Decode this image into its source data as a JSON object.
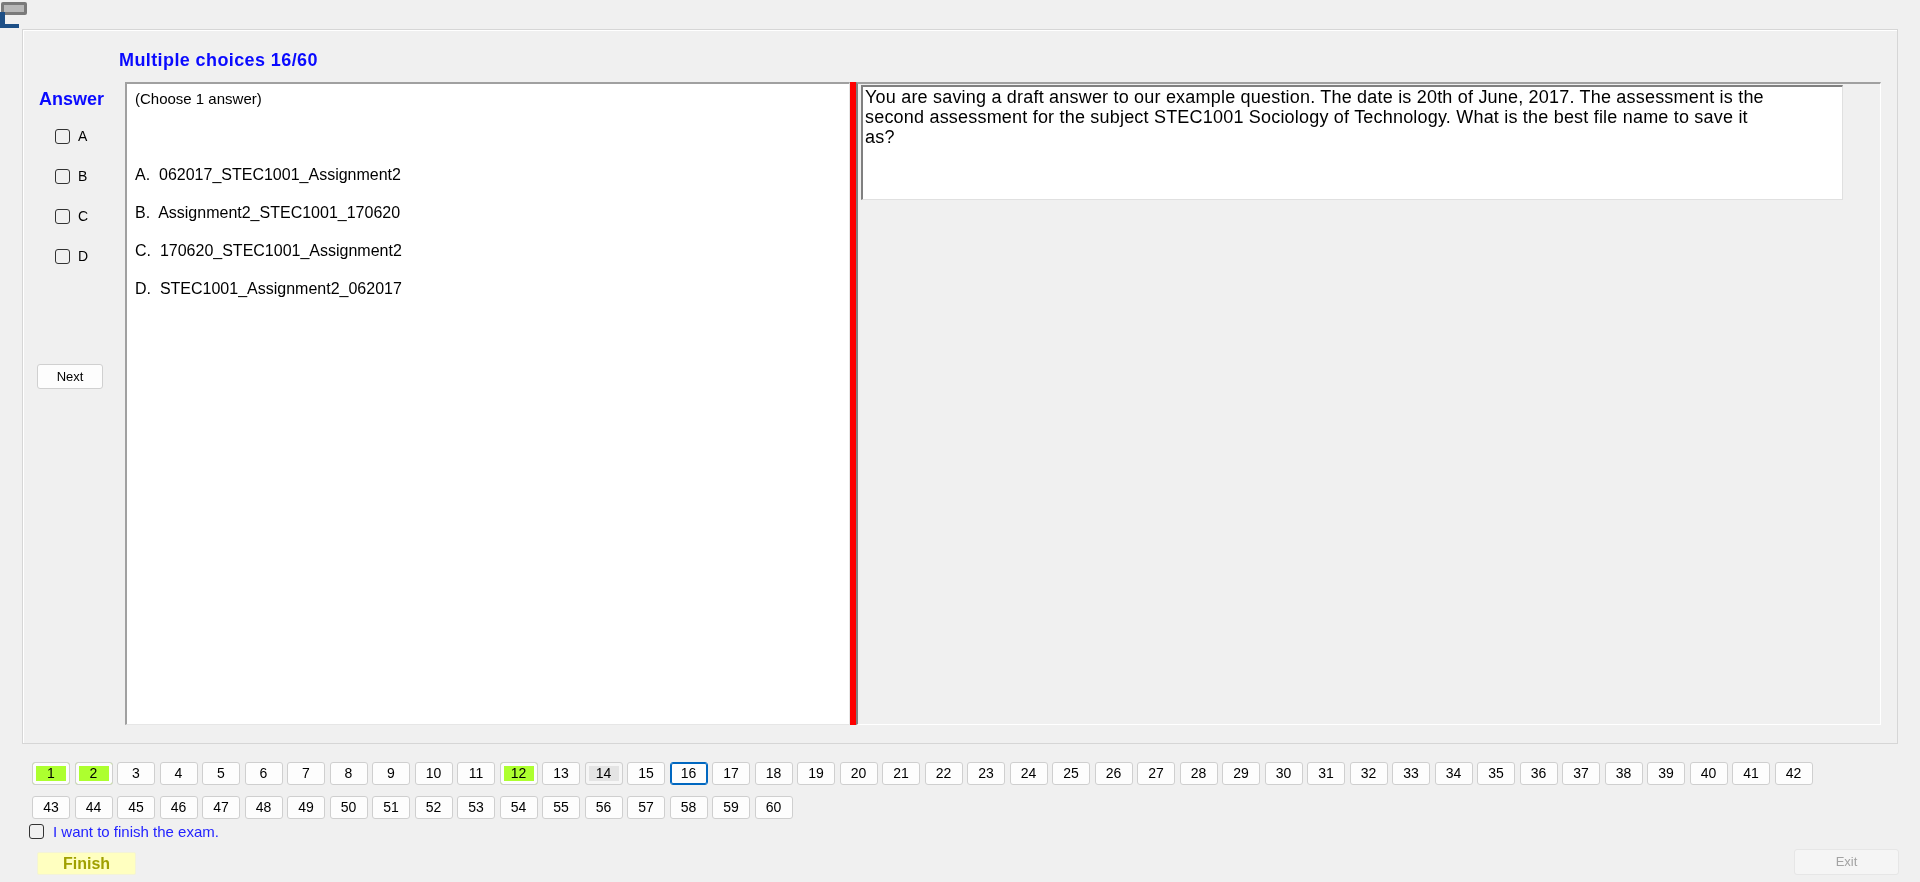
{
  "header": {
    "title": "Multiple choices 16/60"
  },
  "answer_panel": {
    "title": "Answer",
    "options": [
      {
        "label": "A",
        "checked": false
      },
      {
        "label": "B",
        "checked": false
      },
      {
        "label": "C",
        "checked": false
      },
      {
        "label": "D",
        "checked": false
      }
    ],
    "next_button": "Next"
  },
  "choices_panel": {
    "instruction": "(Choose 1 answer)",
    "choices": [
      "A.  062017_STEC1001_Assignment2",
      "B.  Assignment2_STEC1001_170620",
      "C.  170620_STEC1001_Assignment2",
      "D.  STEC1001_Assignment2_062017"
    ]
  },
  "question": {
    "text": "You are saving a draft answer to our example question. The date is 20th of June, 2017. The assessment is the second assessment for the subject STEC1001 Sociology of Technology. What is the best file name to save it as?"
  },
  "question_nav": [
    {
      "label": "1",
      "answered": true,
      "selected": false,
      "highlighted": false
    },
    {
      "label": "2",
      "answered": true,
      "selected": false,
      "highlighted": false
    },
    {
      "label": "3",
      "answered": false,
      "selected": false,
      "highlighted": false
    },
    {
      "label": "4",
      "answered": false,
      "selected": false,
      "highlighted": false
    },
    {
      "label": "5",
      "answered": false,
      "selected": false,
      "highlighted": false
    },
    {
      "label": "6",
      "answered": false,
      "selected": false,
      "highlighted": false
    },
    {
      "label": "7",
      "answered": false,
      "selected": false,
      "highlighted": false
    },
    {
      "label": "8",
      "answered": false,
      "selected": false,
      "highlighted": false
    },
    {
      "label": "9",
      "answered": false,
      "selected": false,
      "highlighted": false
    },
    {
      "label": "10",
      "answered": false,
      "selected": false,
      "highlighted": false
    },
    {
      "label": "11",
      "answered": false,
      "selected": false,
      "highlighted": false
    },
    {
      "label": "12",
      "answered": true,
      "selected": false,
      "highlighted": false
    },
    {
      "label": "13",
      "answered": false,
      "selected": false,
      "highlighted": false
    },
    {
      "label": "14",
      "answered": false,
      "selected": false,
      "highlighted": true
    },
    {
      "label": "15",
      "answered": false,
      "selected": false,
      "highlighted": false
    },
    {
      "label": "16",
      "answered": false,
      "selected": true,
      "highlighted": false
    },
    {
      "label": "17",
      "answered": false,
      "selected": false,
      "highlighted": false
    },
    {
      "label": "18",
      "answered": false,
      "selected": false,
      "highlighted": false
    },
    {
      "label": "19",
      "answered": false,
      "selected": false,
      "highlighted": false
    },
    {
      "label": "20",
      "answered": false,
      "selected": false,
      "highlighted": false
    },
    {
      "label": "21",
      "answered": false,
      "selected": false,
      "highlighted": false
    },
    {
      "label": "22",
      "answered": false,
      "selected": false,
      "highlighted": false
    },
    {
      "label": "23",
      "answered": false,
      "selected": false,
      "highlighted": false
    },
    {
      "label": "24",
      "answered": false,
      "selected": false,
      "highlighted": false
    },
    {
      "label": "25",
      "answered": false,
      "selected": false,
      "highlighted": false
    },
    {
      "label": "26",
      "answered": false,
      "selected": false,
      "highlighted": false
    },
    {
      "label": "27",
      "answered": false,
      "selected": false,
      "highlighted": false
    },
    {
      "label": "28",
      "answered": false,
      "selected": false,
      "highlighted": false
    },
    {
      "label": "29",
      "answered": false,
      "selected": false,
      "highlighted": false
    },
    {
      "label": "30",
      "answered": false,
      "selected": false,
      "highlighted": false
    },
    {
      "label": "31",
      "answered": false,
      "selected": false,
      "highlighted": false
    },
    {
      "label": "32",
      "answered": false,
      "selected": false,
      "highlighted": false
    },
    {
      "label": "33",
      "answered": false,
      "selected": false,
      "highlighted": false
    },
    {
      "label": "34",
      "answered": false,
      "selected": false,
      "highlighted": false
    },
    {
      "label": "35",
      "answered": false,
      "selected": false,
      "highlighted": false
    },
    {
      "label": "36",
      "answered": false,
      "selected": false,
      "highlighted": false
    },
    {
      "label": "37",
      "answered": false,
      "selected": false,
      "highlighted": false
    },
    {
      "label": "38",
      "answered": false,
      "selected": false,
      "highlighted": false
    },
    {
      "label": "39",
      "answered": false,
      "selected": false,
      "highlighted": false
    },
    {
      "label": "40",
      "answered": false,
      "selected": false,
      "highlighted": false
    },
    {
      "label": "41",
      "answered": false,
      "selected": false,
      "highlighted": false
    },
    {
      "label": "42",
      "answered": false,
      "selected": false,
      "highlighted": false
    },
    {
      "label": "43",
      "answered": false,
      "selected": false,
      "highlighted": false
    },
    {
      "label": "44",
      "answered": false,
      "selected": false,
      "highlighted": false
    },
    {
      "label": "45",
      "answered": false,
      "selected": false,
      "highlighted": false
    },
    {
      "label": "46",
      "answered": false,
      "selected": false,
      "highlighted": false
    },
    {
      "label": "47",
      "answered": false,
      "selected": false,
      "highlighted": false
    },
    {
      "label": "48",
      "answered": false,
      "selected": false,
      "highlighted": false
    },
    {
      "label": "49",
      "answered": false,
      "selected": false,
      "highlighted": false
    },
    {
      "label": "50",
      "answered": false,
      "selected": false,
      "highlighted": false
    },
    {
      "label": "51",
      "answered": false,
      "selected": false,
      "highlighted": false
    },
    {
      "label": "52",
      "answered": false,
      "selected": false,
      "highlighted": false
    },
    {
      "label": "53",
      "answered": false,
      "selected": false,
      "highlighted": false
    },
    {
      "label": "54",
      "answered": false,
      "selected": false,
      "highlighted": false
    },
    {
      "label": "55",
      "answered": false,
      "selected": false,
      "highlighted": false
    },
    {
      "label": "56",
      "answered": false,
      "selected": false,
      "highlighted": false
    },
    {
      "label": "57",
      "answered": false,
      "selected": false,
      "highlighted": false
    },
    {
      "label": "58",
      "answered": false,
      "selected": false,
      "highlighted": false
    },
    {
      "label": "59",
      "answered": false,
      "selected": false,
      "highlighted": false
    },
    {
      "label": "60",
      "answered": false,
      "selected": false,
      "highlighted": false
    }
  ],
  "finish_confirm": {
    "label": "I want to finish the exam.",
    "checked": false
  },
  "buttons": {
    "finish": {
      "label": "Finish"
    },
    "exit": {
      "label": "Exit",
      "disabled": true
    }
  }
}
